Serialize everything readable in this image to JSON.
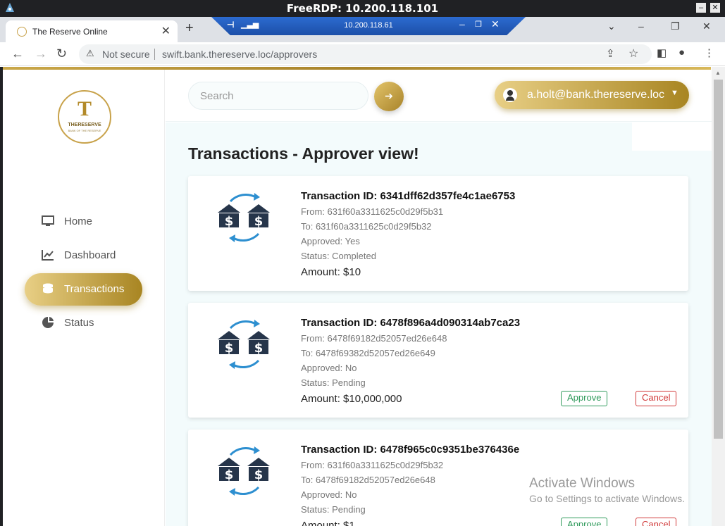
{
  "window": {
    "title": "FreeRDP: 10.200.118.101"
  },
  "rdp_bar": {
    "ip": "10.200.118.61"
  },
  "browser": {
    "tab_title": "The Reserve Online",
    "security_label": "Not secure",
    "url": "swift.bank.thereserve.loc/approvers"
  },
  "logo": {
    "letter": "T",
    "name": "THERESERVE",
    "tagline": "BANK OF THE RESERVE"
  },
  "sidebar": {
    "items": [
      {
        "label": "Home",
        "icon": "monitor-icon"
      },
      {
        "label": "Dashboard",
        "icon": "chart-line-icon"
      },
      {
        "label": "Transactions",
        "icon": "coins-icon",
        "active": true
      },
      {
        "label": "Status",
        "icon": "pie-chart-icon"
      }
    ]
  },
  "header": {
    "search_placeholder": "Search",
    "user_email": "a.holt@bank.thereserve.loc"
  },
  "main": {
    "title": "Transactions - Approver view!",
    "transactions": [
      {
        "id_text": "Transaction ID: 6341dff62d357fe4c1ae6753",
        "from": "From: 631f60a3311625c0d29f5b31",
        "to": "To: 631f60a3311625c0d29f5b32",
        "approved": "Approved: Yes",
        "status": "Status: Completed",
        "amount": "Amount: $10"
      },
      {
        "id_text": "Transaction ID: 6478f896a4d090314ab7ca23",
        "from": "From: 6478f69182d52057ed26e648",
        "to": "To: 6478f69382d52057ed26e649",
        "approved": "Approved: No",
        "status": "Status: Pending",
        "amount": "Amount: $10,000,000",
        "approve_label": "Approve",
        "cancel_label": "Cancel"
      },
      {
        "id_text": "Transaction ID: 6478f965c0c9351be376436e",
        "from": "From: 631f60a3311625c0d29f5b32",
        "to": "To: 6478f69182d52057ed26e648",
        "approved": "Approved: No",
        "status": "Status: Pending",
        "amount": "Amount: $1",
        "approve_label": "Approve",
        "cancel_label": "Cancel"
      }
    ]
  },
  "watermark": {
    "line1": "Activate Windows",
    "line2": "Go to Settings to activate Windows."
  },
  "colors": {
    "gold_light": "#e8cf85",
    "gold_dark": "#a88522",
    "approve": "#2e9a5a",
    "cancel": "#d13a3a",
    "content_bg": "#f3fbfc"
  }
}
